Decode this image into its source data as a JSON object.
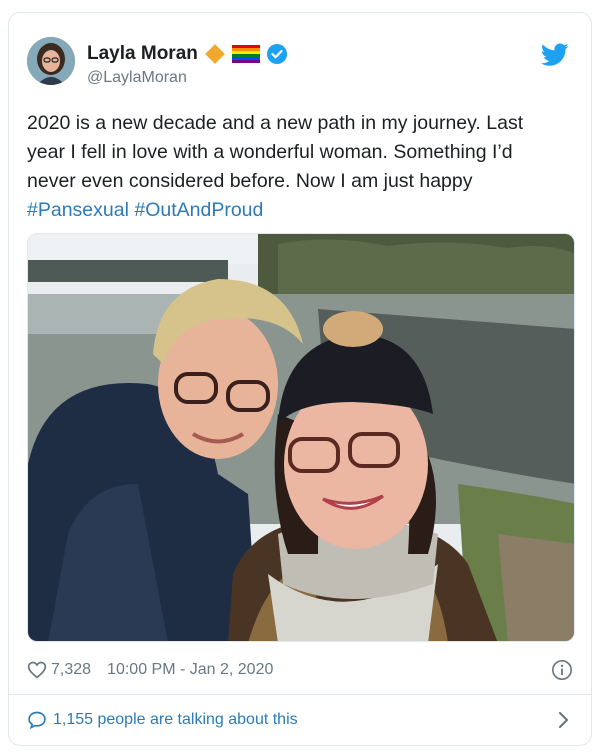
{
  "tweet": {
    "display_name": "Layla Moran",
    "handle": "@LaylaMoran",
    "text_lines": [
      "2020 is a new decade and a new path in my journey. Last",
      "year I fell in love with a wonderful woman. Something I’d",
      "never even considered before. Now I am just happy"
    ],
    "hashtags": [
      "#Pansexual",
      "#OutAndProud"
    ],
    "likes": "7,328",
    "timestamp": "10:00 PM - Jan 2, 2020",
    "talking": "1,155 people are talking about this"
  },
  "colors": {
    "link": "#2b7bb9",
    "twitter_blue": "#1da1f2",
    "muted": "#697882",
    "border": "#e1e8ed",
    "badge_orange": "#f0a830"
  },
  "icons": {
    "badges": [
      "orange-diamond-icon",
      "rainbow-flag-icon",
      "verified-badge-icon"
    ],
    "brand": "twitter-bird-icon",
    "like": "heart-icon",
    "info": "info-icon",
    "talking": "speech-bubble-icon",
    "more": "chevron-right-icon"
  }
}
